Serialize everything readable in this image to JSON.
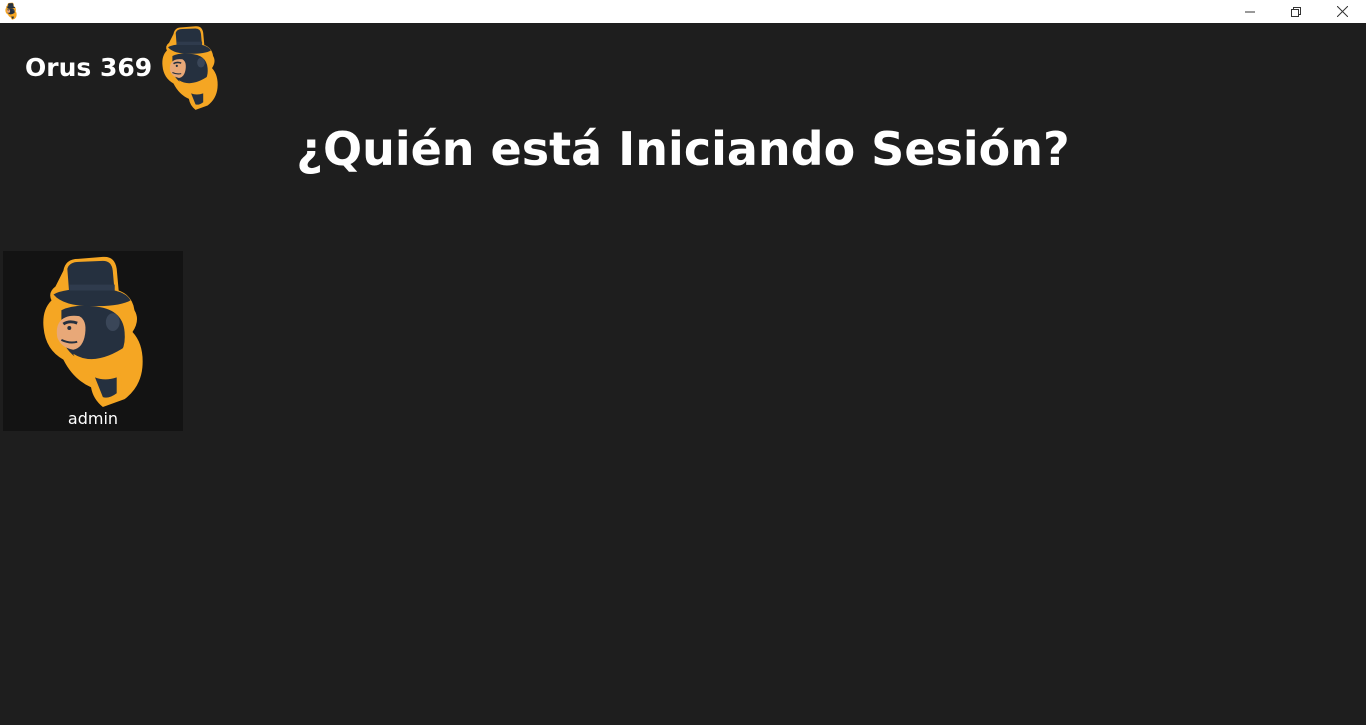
{
  "window": {
    "controls": {
      "minimize_icon": "minimize-icon",
      "maximize_icon": "restore-icon",
      "close_icon": "close-icon"
    }
  },
  "brand": {
    "name": "Orus 369",
    "logo_icon": "gorilla-top-hat-logo"
  },
  "heading": "¿Quién está Iniciando Sesión?",
  "profiles": [
    {
      "name": "admin",
      "avatar_icon": "gorilla-top-hat-avatar"
    }
  ],
  "colors": {
    "background": "#1e1e1e",
    "card": "#131313",
    "accent": "#f5a623",
    "hat": "#25303f",
    "text": "#ffffff"
  }
}
